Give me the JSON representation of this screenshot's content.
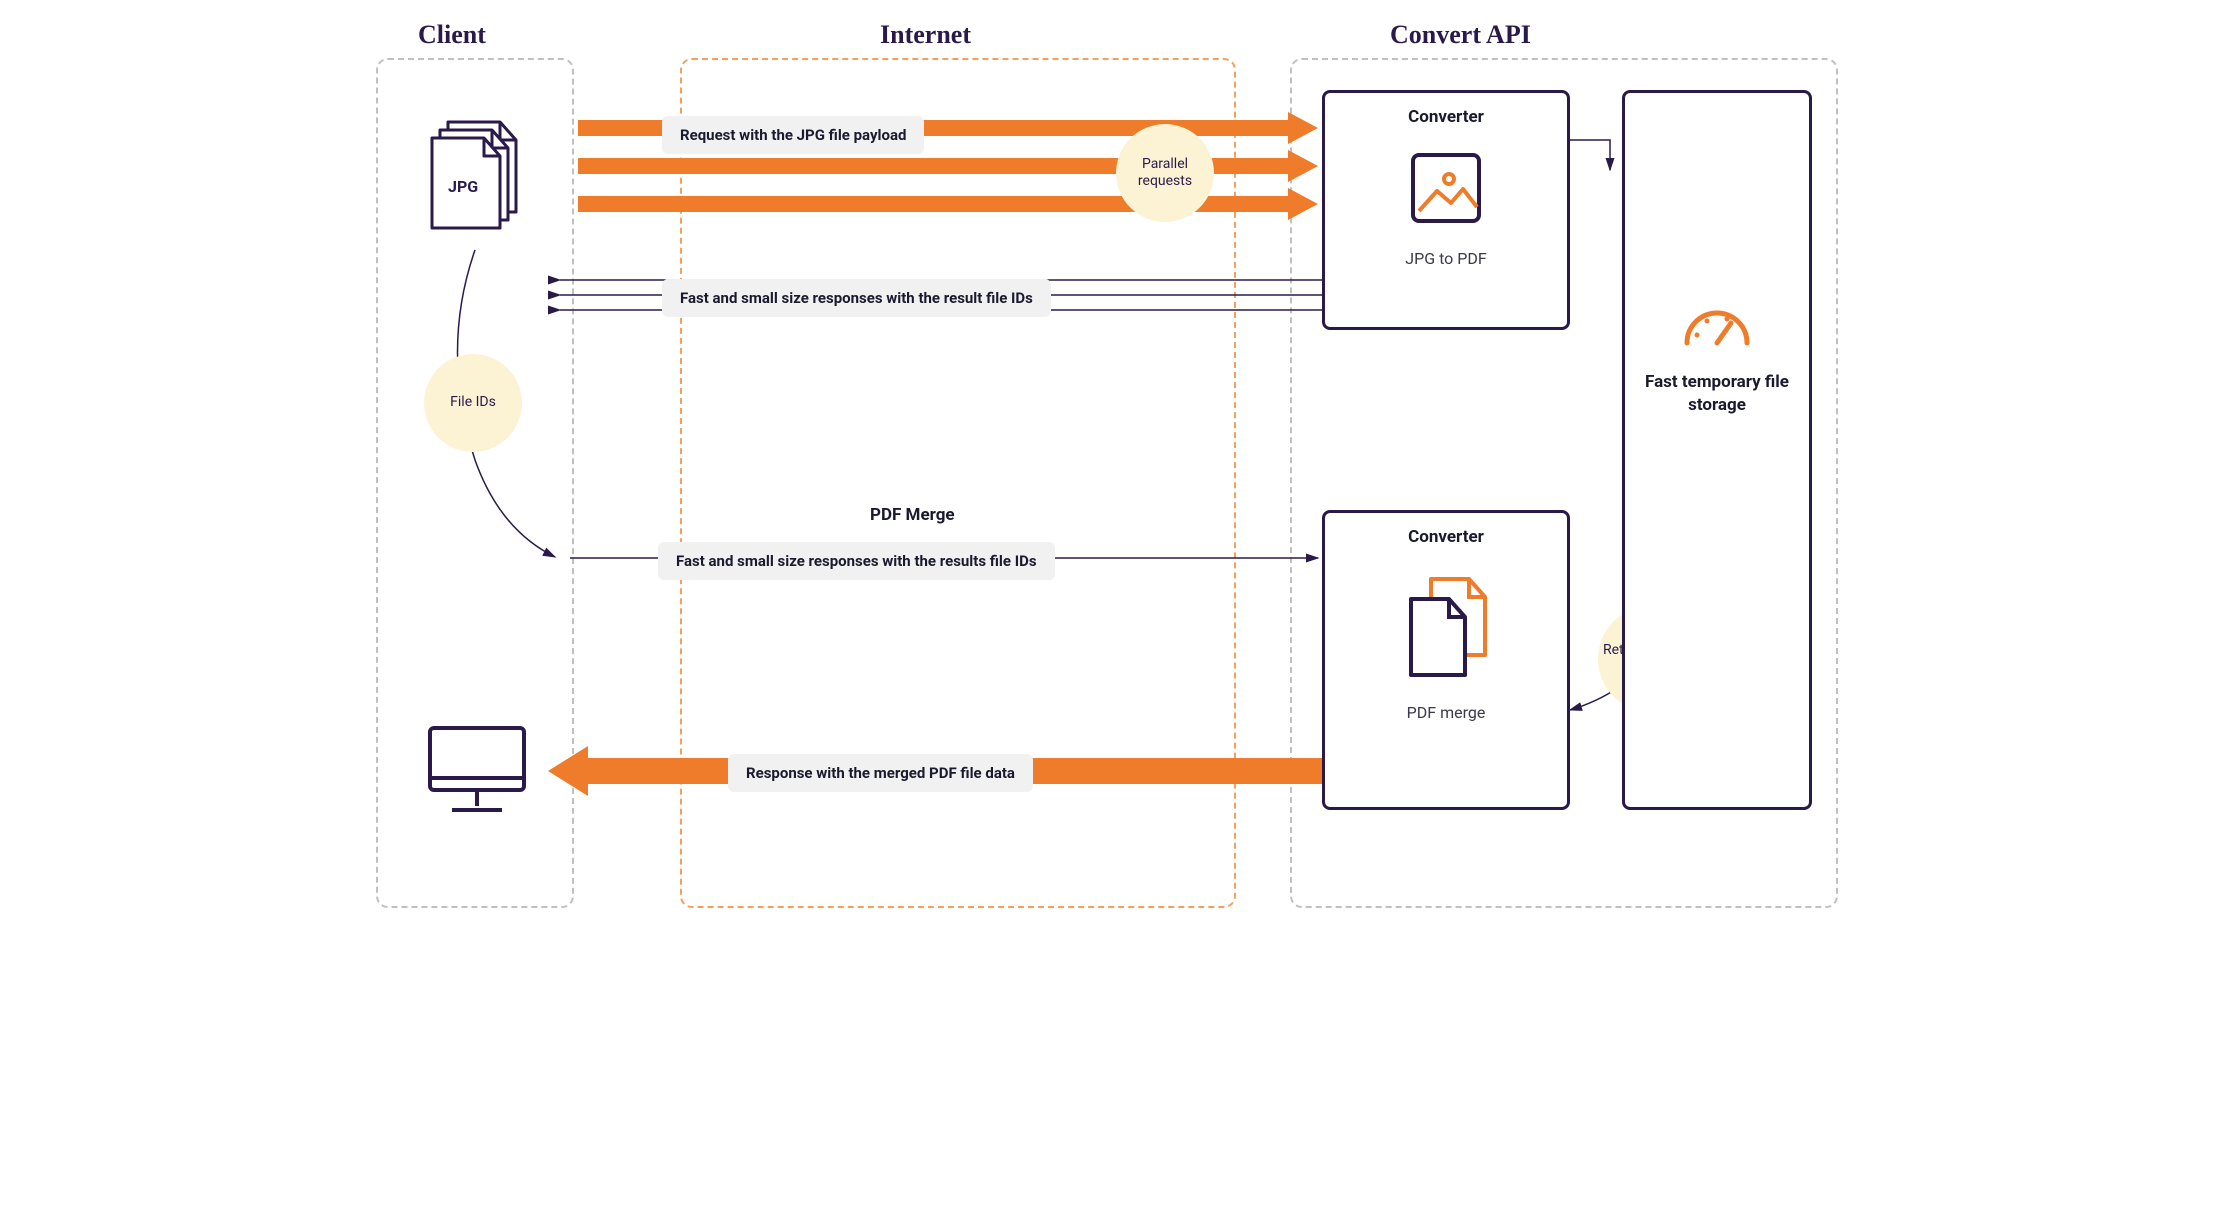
{
  "columns": {
    "client": "Client",
    "internet": "Internet",
    "api": "Convert API"
  },
  "file_badge": "JPG",
  "circles": {
    "parallel": "Parallel requests",
    "fileids": "File IDs",
    "retrieve": "Retrieve source files"
  },
  "labels": {
    "req_payload": "Request with the JPG file payload",
    "resp_ids": "Fast and small size responses with the result file IDs",
    "pdf_merge_title": "PDF Merge",
    "req_merge": "Fast and small size responses with the results file IDs",
    "resp_merged": "Response with the merged PDF file data"
  },
  "converter1": {
    "title": "Converter",
    "sub": "JPG to PDF"
  },
  "converter2": {
    "title": "Converter",
    "sub": "PDF merge"
  },
  "storage": {
    "title": "Fast temporary file storage"
  },
  "colors": {
    "orange": "#ee7c2b",
    "navy": "#2a1a4a",
    "cream": "#fcf3d4",
    "grey": "#f1f1f1"
  }
}
